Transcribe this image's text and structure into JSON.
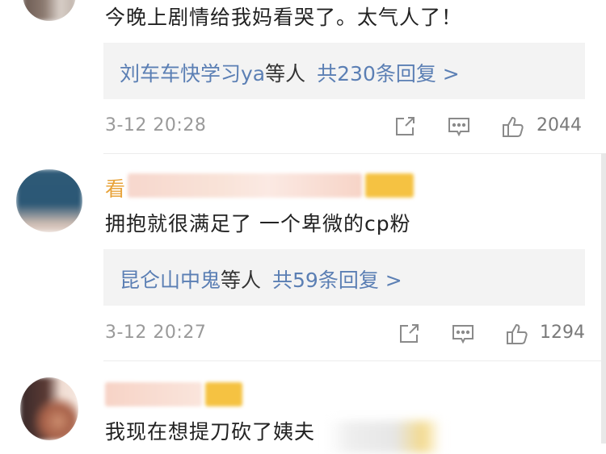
{
  "comments": [
    {
      "text": "今晚上剧情给我妈看哭了。太气人了！",
      "reply_users": "刘车车快学习ya",
      "reply_suffix": "等人",
      "reply_count": "共230条回复 >",
      "time": "3-12 20:28",
      "likes": "2044"
    },
    {
      "username_visible": "看",
      "text": "拥抱就很满足了  一个卑微的cp粉",
      "reply_users": "昆仑山中鬼",
      "reply_suffix": "等人",
      "reply_count": "共59条回复 >",
      "time": "3-12 20:27",
      "likes": "1294"
    },
    {
      "text": "我现在想提刀砍了姨夫"
    }
  ],
  "colors": {
    "link_blue": "#5b7fb4",
    "reply_bg": "#f3f3f3",
    "meta_gray": "#9a9a9a",
    "badge_yellow": "#f5c242"
  },
  "icons": [
    "share-icon",
    "comment-icon",
    "thumbs-up-icon"
  ]
}
